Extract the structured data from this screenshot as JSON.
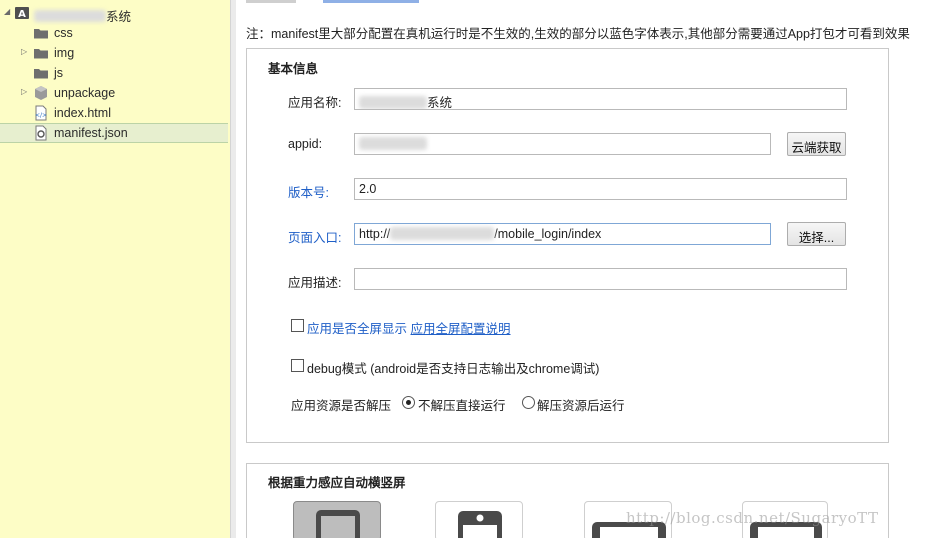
{
  "sidebar": {
    "project": {
      "name_suffix": "系统"
    },
    "items": [
      {
        "label": "css",
        "type": "folder"
      },
      {
        "label": "img",
        "type": "folder"
      },
      {
        "label": "js",
        "type": "folder"
      },
      {
        "label": "unpackage",
        "type": "package"
      },
      {
        "label": "index.html",
        "type": "html-file"
      },
      {
        "label": "manifest.json",
        "type": "json-file",
        "selected": true
      }
    ]
  },
  "main": {
    "note": "注：manifest里大部分配置在真机运行时是不生效的,生效的部分以蓝色字体表示,其他部分需要通过App打包才可看到效果",
    "basic": {
      "title": "基本信息",
      "app_name_label": "应用名称:",
      "app_name_suffix": "系统",
      "appid_label": "appid:",
      "cloud_button": "云端获取",
      "version_label": "版本号:",
      "version_value": "2.0",
      "entry_label": "页面入口:",
      "entry_prefix": "http://",
      "entry_suffix": "/mobile_login/index",
      "choose_button": "选择...",
      "desc_label": "应用描述:",
      "desc_value": "",
      "fullscreen_label": "应用是否全屏显示",
      "fullscreen_link": "应用全屏配置说明",
      "debug_label": "debug模式 (android是否支持日志输出及chrome调试)",
      "unzip_label": "应用资源是否解压",
      "unzip_options": [
        "不解压直接运行",
        "解压资源后运行"
      ],
      "unzip_selected": 0
    },
    "orientation": {
      "title": "根据重力感应自动横竖屏"
    },
    "watermark": "http://blog.csdn.net/SugaryoTT"
  },
  "colors": {
    "sidebar_bg": "#fdfdc6",
    "selected_row": "#e7efcf",
    "link_blue": "#1f5fc7"
  }
}
